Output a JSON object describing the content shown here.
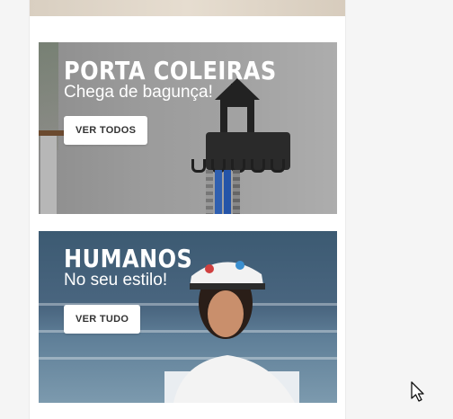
{
  "banners": [
    {
      "title": "PORTA COLEIRAS",
      "subtitle": "Chega de bagunça!",
      "button_label": "VER TODOS"
    },
    {
      "title": "HUMANOS",
      "subtitle": "No seu estilo!",
      "button_label": "VER TUDO"
    }
  ],
  "colors": {
    "page_background": "#f5f5f5",
    "button_background": "#ffffff",
    "button_text": "#333333",
    "title_text": "#ffffff"
  },
  "icons": [
    "mouse-pointer-icon"
  ]
}
